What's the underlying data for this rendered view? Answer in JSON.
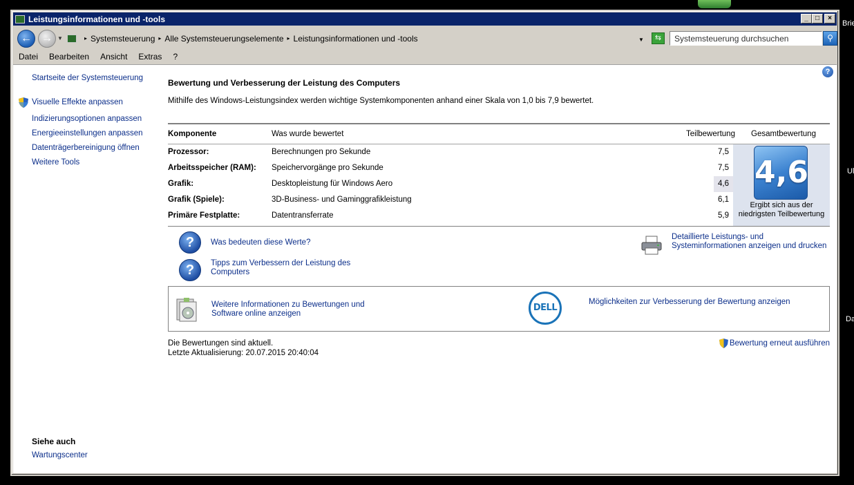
{
  "desktop": {
    "labels": [
      "Brie",
      "Ul",
      "Da"
    ]
  },
  "window": {
    "title": "Leistungsinformationen und -tools",
    "buttons": {
      "minimize": "_",
      "maximize": "□",
      "close": "×"
    }
  },
  "address": {
    "crumbs": [
      "Systemsteuerung",
      "Alle Systemsteuerungselemente",
      "Leistungsinformationen und -tools"
    ],
    "search_placeholder": "Systemsteuerung durchsuchen"
  },
  "menu": [
    "Datei",
    "Bearbeiten",
    "Ansicht",
    "Extras",
    "?"
  ],
  "sidebar": {
    "links": [
      "Startseite der Systemsteuerung",
      "Visuelle Effekte anpassen",
      "Indizierungsoptionen anpassen",
      "Energieeinstellungen anpassen",
      "Datenträgerbereinigung öffnen",
      "Weitere Tools"
    ],
    "see_also_heading": "Siehe auch",
    "see_also": [
      "Wartungscenter"
    ]
  },
  "main": {
    "title": "Bewertung und Verbesserung der Leistung des Computers",
    "description": "Mithilfe des Windows-Leistungsindex werden wichtige Systemkomponenten anhand einer Skala von 1,0 bis 7,9 bewertet.",
    "table": {
      "headers": [
        "Komponente",
        "Was wurde bewertet",
        "Teilbewertung",
        "Gesamtbewertung"
      ],
      "rows": [
        {
          "component": "Prozessor:",
          "what": "Berechnungen pro Sekunde",
          "score": "7,5"
        },
        {
          "component": "Arbeitsspeicher (RAM):",
          "what": "Speichervorgänge pro Sekunde",
          "score": "7,5"
        },
        {
          "component": "Grafik:",
          "what": "Desktopleistung für Windows Aero",
          "score": "4,6"
        },
        {
          "component": "Grafik (Spiele):",
          "what": "3D-Business- und Gaminggrafikleistung",
          "score": "6,1"
        },
        {
          "component": "Primäre Festplatte:",
          "what": "Datentransferrate",
          "score": "5,9"
        }
      ],
      "overall_score": "4,6",
      "overall_caption": "Ergibt sich aus der niedrigsten Teilbewertung"
    },
    "links": {
      "what_mean": "Was bedeuten diese Werte?",
      "tips": "Tipps zum Verbessern der Leistung des Computers",
      "details": "Detaillierte Leistungs- und Systeminformationen anzeigen und drucken",
      "more_info": "Weitere Informationen zu Bewertungen und Software online anzeigen",
      "dell": "Möglichkeiten zur Verbesserung der Bewertung anzeigen",
      "rerun": "Bewertung erneut ausführen"
    },
    "dell_logo_text": "DELL",
    "status_line1": "Die Bewertungen sind aktuell.",
    "status_line2": "Letzte Aktualisierung: 20.07.2015 20:40:04"
  }
}
